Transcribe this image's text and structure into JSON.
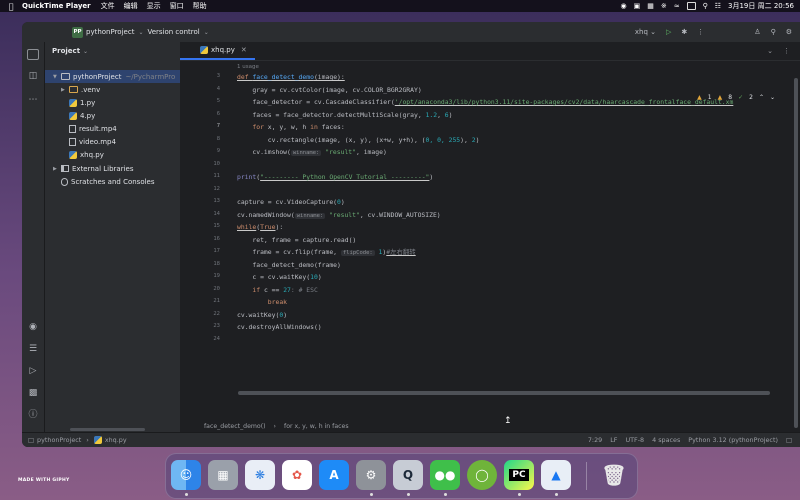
{
  "menubar": {
    "app": "QuickTime Player",
    "items": [
      "文件",
      "编辑",
      "显示",
      "窗口",
      "帮助"
    ],
    "datetime": "3月19日 周二 20:56"
  },
  "titlebar": {
    "project_badge": "PP",
    "project": "pythonProject",
    "vcs": "Version control",
    "run_config": "xhq"
  },
  "project_panel": {
    "title": "Project",
    "root": "pythonProject",
    "root_path": "~/PycharmPro",
    "items": [
      ".venv",
      "1.py",
      "4.py",
      "result.mp4",
      "video.mp4",
      "xhq.py"
    ],
    "external": "External Libraries",
    "scratches": "Scratches and Consoles"
  },
  "editor": {
    "tab": "xhq.py",
    "usage": "1 usage",
    "inspections": {
      "warnings": "1",
      "weak": "8",
      "typos": "2"
    },
    "line_numbers": [
      "3",
      "4",
      "5",
      "6",
      "7",
      "8",
      "9",
      "10",
      "11",
      "12",
      "13",
      "14",
      "15",
      "16",
      "17",
      "18",
      "19",
      "20",
      "21",
      "22",
      "23",
      "24"
    ],
    "code": {
      "l3_kw": "def ",
      "l3_fn": "face_detect_demo",
      "l3_rest": "(image):",
      "l4": "    gray = cv.cvtColor(image, cv.COLOR_BGR2GRAY)",
      "l5_a": "    face_detector = cv.CascadeClassifier(",
      "l5_str": "'/opt/anaconda3/lib/python3.11/site-packages/cv2/data/haarcascade_frontalface_default.xm",
      "l6_a": "    faces = face_detector.detectMultiScale(gray, ",
      "l6_n1": "1.2",
      "l6_b": ", ",
      "l6_n2": "6",
      "l6_c": ")",
      "l7_kw1": "    for ",
      "l7_a": "x, y, w, h ",
      "l7_kw2": "in ",
      "l7_b": "faces:",
      "l8_a": "        cv.rectangle(image, (x, y), (x+w, y+h), (",
      "l8_n": "0, 0, 255",
      "l8_b": "), ",
      "l8_n2": "2",
      "l8_c": ")",
      "l9_a": "    cv.imshow(",
      "l9_hint": "winname:",
      "l9_str": " \"result\"",
      "l9_b": ", image)",
      "l11_fn": "print",
      "l11_a": "(",
      "l11_str": "\"--------- Python OpenCV Tutorial ---------\"",
      "l11_b": ")",
      "l13_a": "capture = cv.VideoCapture(",
      "l13_n": "0",
      "l13_b": ")",
      "l14_a": "cv.namedWindow(",
      "l14_hint": "winname:",
      "l14_str": " \"result\"",
      "l14_b": ", cv.WINDOW_AUTOSIZE)",
      "l15_kw": "while",
      "l15_a": "(",
      "l15_kw2": "True",
      "l15_b": "):",
      "l16": "    ret, frame = capture.read()",
      "l17_a": "    frame = cv.flip(frame, ",
      "l17_hint": "flipCode:",
      "l17_n": " 1",
      "l17_b": ")",
      "l17_cm": "#左右翻转",
      "l18": "    face_detect_demo(frame)",
      "l19_a": "    c = cv.waitKey(",
      "l19_n": "10",
      "l19_b": ")",
      "l20_kw": "    if ",
      "l20_a": "c == ",
      "l20_n": "27",
      "l20_cm": ": # ESC",
      "l21_kw": "        break",
      "l22_a": "cv.waitKey(",
      "l22_n": "0",
      "l22_b": ")",
      "l23": "cv.destroyAllWindows()"
    },
    "breadcrumb": [
      "face_detect_demo()",
      "for x, y, w, h in faces"
    ]
  },
  "statusbar": {
    "project": "pythonProject",
    "file": "xhq.py",
    "position": "7:29",
    "line_sep": "LF",
    "encoding": "UTF-8",
    "indent": "4 spaces",
    "interpreter": "Python 3.12 (pythonProject)"
  },
  "dock": {
    "pycharm_label": "PC"
  },
  "watermark": "MADE WITH GIPHY"
}
